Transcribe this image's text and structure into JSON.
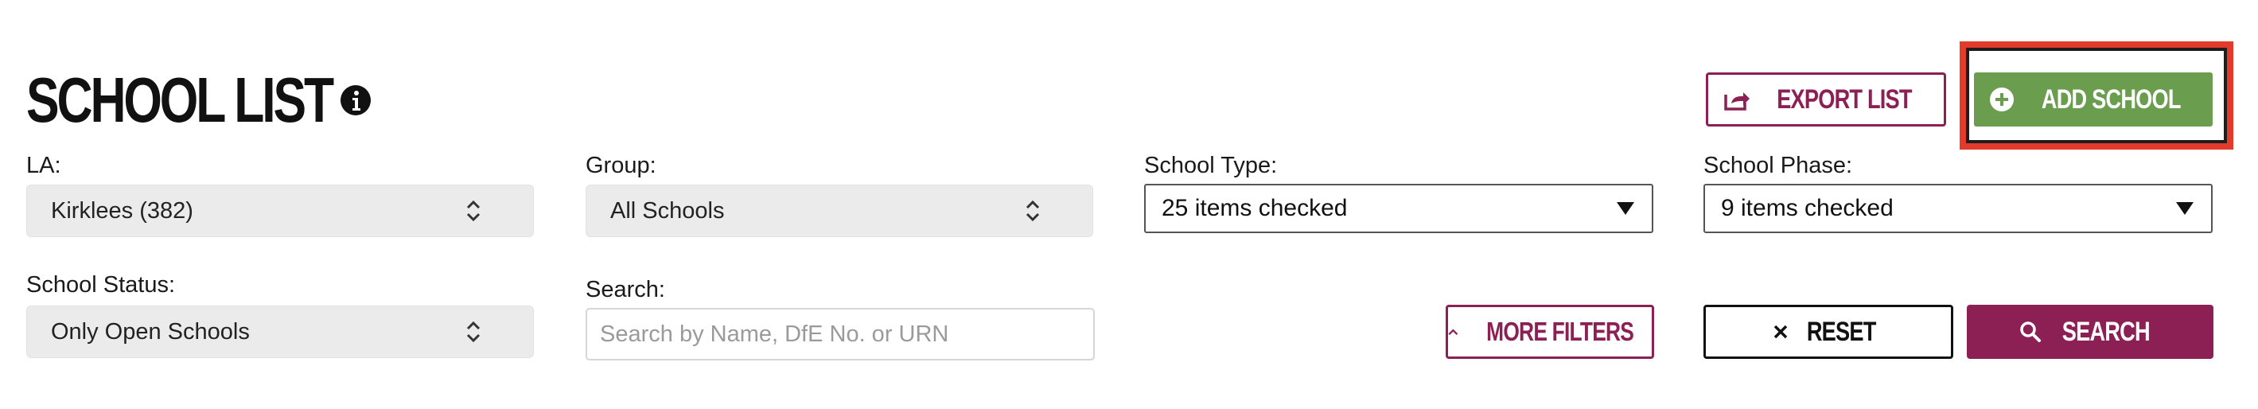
{
  "header": {
    "title": "SCHOOL LIST",
    "export_label": "EXPORT LIST",
    "add_label": "ADD SCHOOL"
  },
  "filters": {
    "la": {
      "label": "LA:",
      "value": "Kirklees (382)"
    },
    "group": {
      "label": "Group:",
      "value": "All Schools"
    },
    "school_type": {
      "label": "School Type:",
      "value": "25 items checked"
    },
    "school_phase": {
      "label": "School Phase:",
      "value": "9 items checked"
    },
    "school_status": {
      "label": "School Status:",
      "value": "Only Open Schools"
    },
    "search": {
      "label": "Search:",
      "value": "",
      "placeholder": "Search by Name, DfE No. or URN"
    }
  },
  "actions": {
    "more_filters_label": "MORE FILTERS",
    "reset_label": "RESET",
    "search_label": "SEARCH"
  },
  "colors": {
    "maroon": "#8c1f53",
    "green": "#6a9d4e",
    "highlight": "#e23b2c"
  },
  "icons": {
    "info": "info-icon",
    "export": "export-icon",
    "add": "plus-circle-icon",
    "updown": "chevron-up-down-icon",
    "caret": "caret-down-icon",
    "more": "chevron-up-icon",
    "reset": "close-icon",
    "search": "search-icon"
  }
}
